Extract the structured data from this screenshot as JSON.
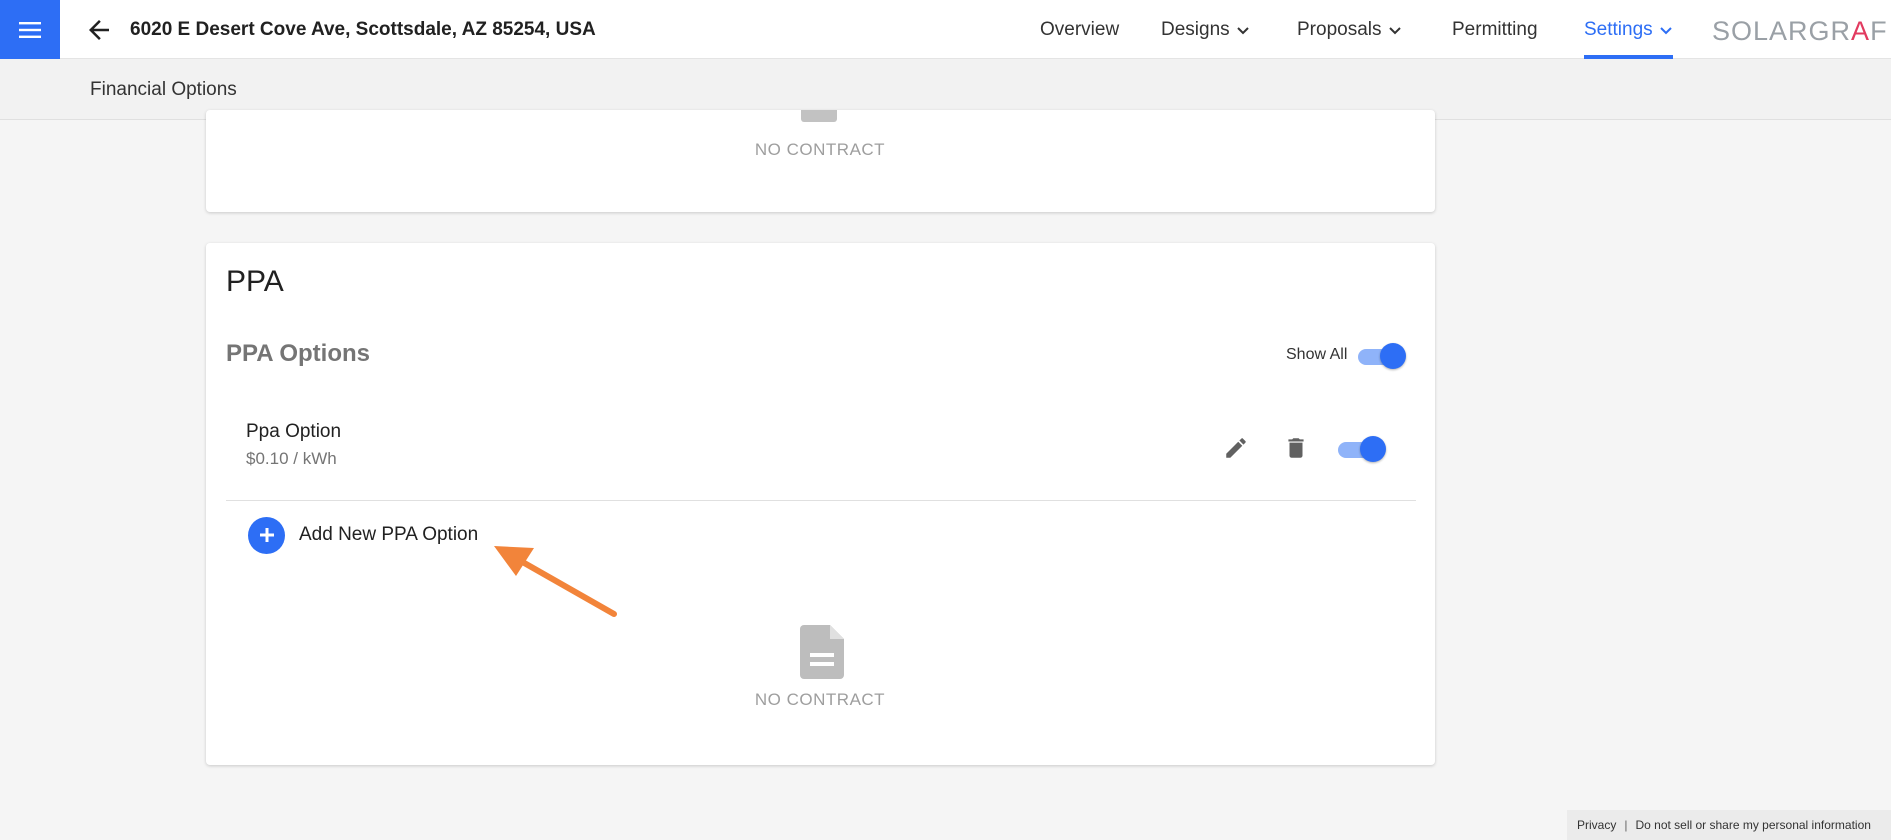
{
  "header": {
    "address": "6020 E Desert Cove Ave, Scottsdale, AZ 85254, USA",
    "nav": [
      {
        "label": "Overview"
      },
      {
        "label": "Designs"
      },
      {
        "label": "Proposals"
      },
      {
        "label": "Permitting"
      },
      {
        "label": "Settings"
      }
    ],
    "logo": {
      "part1": "SOLARGR",
      "accent": "A",
      "part2": "F"
    },
    "accent_color": "#2d6ef5"
  },
  "subbar": {
    "title": "Financial Options"
  },
  "top_card": {
    "empty_label": "NO CONTRACT"
  },
  "ppa_card": {
    "heading": "PPA",
    "options_title": "PPA Options",
    "show_all_label": "Show All",
    "show_all_on": true,
    "options": [
      {
        "name": "Ppa Option",
        "price": "$0.10 / kWh",
        "enabled": true
      }
    ],
    "add_label": "Add New PPA Option",
    "empty_label": "NO CONTRACT"
  },
  "footer": {
    "privacy": "Privacy",
    "separator": "|",
    "do_not_sell": "Do not sell or share my personal information"
  },
  "icons": [
    "menu-icon",
    "back-arrow-icon",
    "chevron-down-icon",
    "pencil-icon",
    "trash-icon",
    "plus-icon",
    "document-icon"
  ]
}
